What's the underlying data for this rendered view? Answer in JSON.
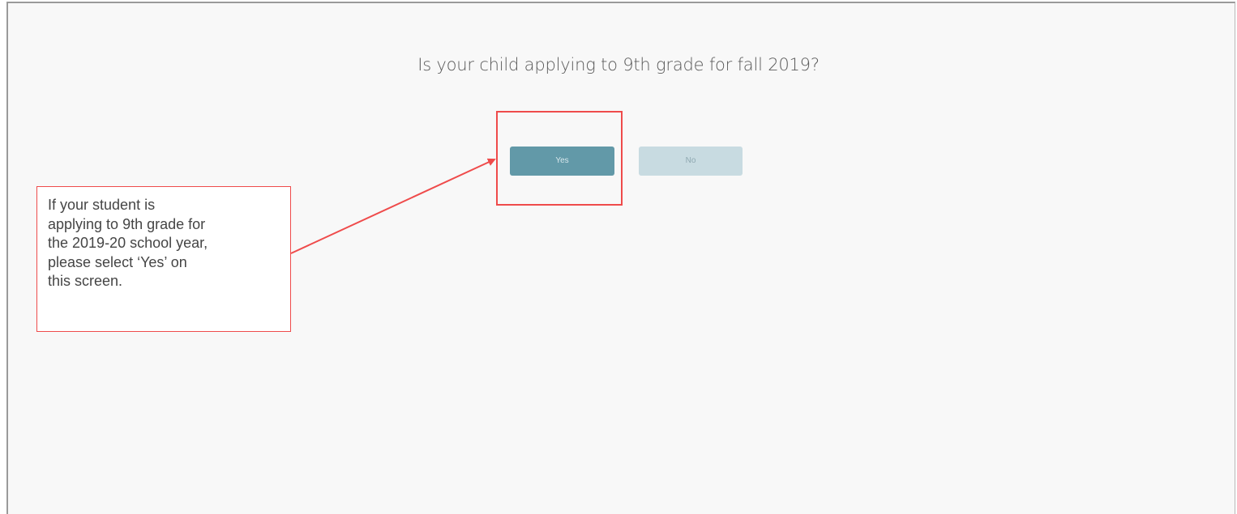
{
  "question": {
    "text": "Is your child applying to 9th grade for fall 2019?"
  },
  "buttons": {
    "yes_label": "Yes",
    "no_label": "No"
  },
  "annotation": {
    "callout_text": "If your student is applying to 9th grade for the 2019-20 school year, please select ‘Yes’ on this screen.",
    "accent_color": "#ef4b4b"
  },
  "colors": {
    "yes_button": "#6299a8",
    "no_button": "#c8dbe1",
    "background": "#f8f8f8"
  }
}
